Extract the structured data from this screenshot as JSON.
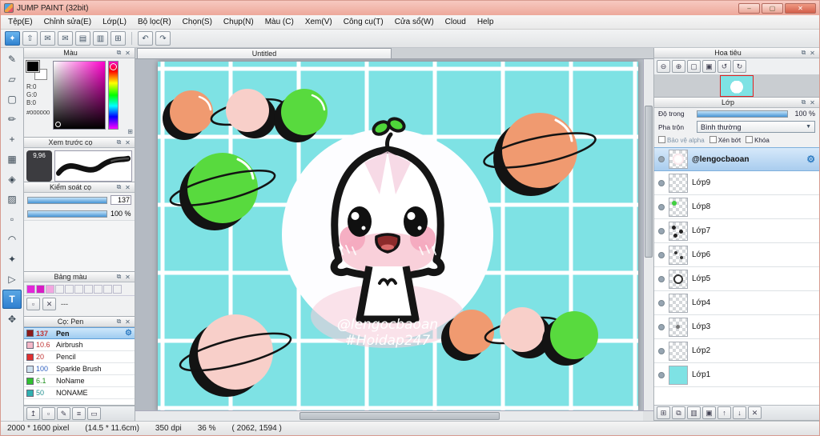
{
  "titlebar": {
    "title": "JUMP PAINT (32bit)"
  },
  "menu": {
    "items": [
      "Tệp(E)",
      "Chỉnh sửa(E)",
      "Lớp(L)",
      "Bộ lọc(R)",
      "Chọn(S)",
      "Chụp(N)",
      "Màu (C)",
      "Xem(V)",
      "Công cụ(T)",
      "Cửa sổ(W)",
      "Cloud",
      "Help"
    ]
  },
  "canvas": {
    "tab": "Untitled",
    "credit1": "@lengocbaoan",
    "credit2": "#Hoidap247"
  },
  "color_panel": {
    "title": "Màu",
    "r": "R:0",
    "g": "G:0",
    "b": "B:0",
    "hex": "#000000"
  },
  "preview_panel": {
    "title": "Xem trước cọ",
    "size": "9,96"
  },
  "control_panel": {
    "title": "Kiểm soát cọ",
    "size_value": "137",
    "opacity_value": "100 %"
  },
  "palette_panel": {
    "title": "Bảng màu",
    "label": "---"
  },
  "brush_panel": {
    "title": "Cọ: Pen",
    "brushes": [
      {
        "size": "137",
        "name": "Pen"
      },
      {
        "size": "10.6",
        "name": "Airbrush"
      },
      {
        "size": "20",
        "name": "Pencil"
      },
      {
        "size": "100",
        "name": "Sparkle Brush"
      },
      {
        "size": "6.1",
        "name": "NoName"
      },
      {
        "size": "50",
        "name": "NONAME"
      }
    ]
  },
  "navigator_panel": {
    "title": "Hoa tiêu"
  },
  "layer_panel": {
    "title": "Lớp",
    "opacity_label": "Độ trong",
    "opacity_value": "100 %",
    "blend_label": "Pha trộn",
    "blend_value": "Bình thường",
    "check1": "Bảo vệ alpha",
    "check2": "Xén bớt",
    "check3": "Khóa",
    "layers": [
      {
        "name": "@lengocbaoan"
      },
      {
        "name": "Lớp9"
      },
      {
        "name": "Lớp8"
      },
      {
        "name": "Lớp7"
      },
      {
        "name": "Lớp6"
      },
      {
        "name": "Lớp5"
      },
      {
        "name": "Lớp4"
      },
      {
        "name": "Lớp3"
      },
      {
        "name": "Lớp2"
      },
      {
        "name": "Lớp1"
      }
    ]
  },
  "statusbar": {
    "size": "2000 * 1600 pixel",
    "dims": "(14.5 * 11.6cm)",
    "dpi": "350 dpi",
    "zoom": "36 %",
    "coords": "( 2062, 1594 )"
  },
  "colors": {
    "accent": "#2f7fd0",
    "canvas_bg": "#7ee2e4",
    "selection": "#a9cdee"
  },
  "icons": {
    "min": "–",
    "max": "▢",
    "close": "✕",
    "popout": "⧉",
    "xclose": "✕",
    "undo": "↶",
    "redo": "↷",
    "app": "✦",
    "share": "⇧",
    "chat": "✉",
    "chat2": "✉",
    "doc": "▤",
    "doc2": "▥",
    "grid": "⊞",
    "tools": [
      "✎",
      "▱",
      "▢",
      "✏",
      "+",
      "▦",
      "◈",
      "▨",
      "▫",
      "◠",
      "✦",
      "▷",
      "T",
      "✥"
    ],
    "zoom_out": "⊖",
    "zoom_in": "⊕",
    "fit": "▢",
    "actual": "▣",
    "rot_l": "↺",
    "rot_r": "↻",
    "gear": "⚙",
    "pal_new": "▫",
    "pal_del": "✕",
    "foot_left": [
      "↥",
      "▫",
      "✎",
      "≡",
      "▭"
    ],
    "layer_foot": [
      "⊞",
      "⧉",
      "▥",
      "▣",
      "↑",
      "↓",
      "✕"
    ]
  }
}
